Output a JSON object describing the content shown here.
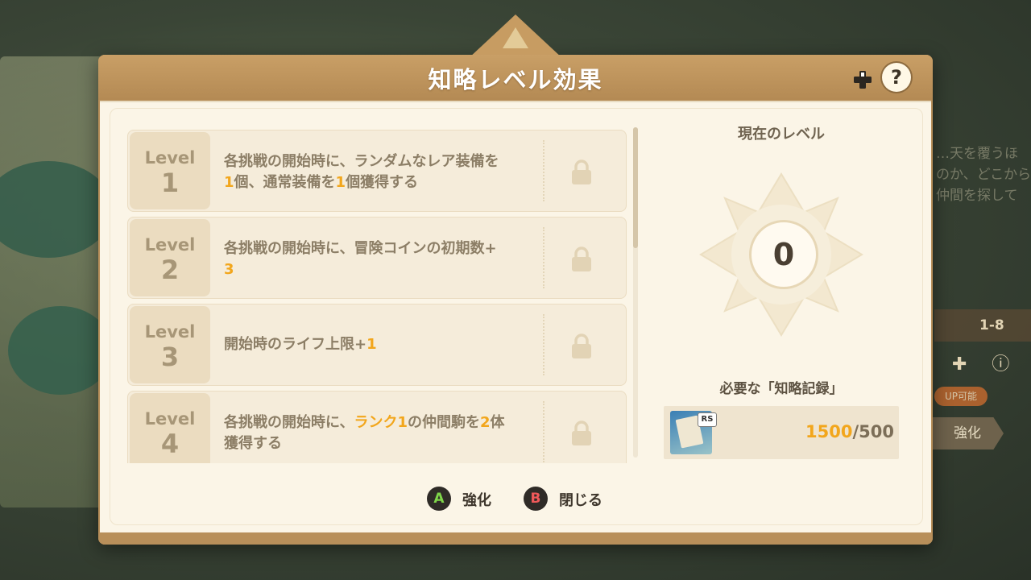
{
  "background": {
    "side_text": [
      "…天を覆うほ",
      "のか、どこから",
      "仲間を探して"
    ],
    "stage": "1-8",
    "badge": "UP可能",
    "enhance": "強化"
  },
  "dialog": {
    "title": "知略レベル効果",
    "help_label": "?"
  },
  "levels": [
    {
      "word": "Level",
      "number": "1",
      "line1": [
        {
          "t": "各挑戦の開始時に、ランダムなレア装備を"
        }
      ],
      "line2": [
        {
          "t": "1",
          "hl": true
        },
        {
          "t": "個、通常装備を"
        },
        {
          "t": "1",
          "hl": true
        },
        {
          "t": "個獲得する"
        }
      ]
    },
    {
      "word": "Level",
      "number": "2",
      "line1": [
        {
          "t": "各挑戦の開始時に、冒険コインの初期数+"
        }
      ],
      "line2": [
        {
          "t": "3",
          "hl": true
        }
      ]
    },
    {
      "word": "Level",
      "number": "3",
      "line1": [
        {
          "t": "開始時のライフ上限+"
        },
        {
          "t": "1",
          "hl": true
        }
      ],
      "line2": []
    },
    {
      "word": "Level",
      "number": "4",
      "line1": [
        {
          "t": "各挑戦の開始時に、"
        },
        {
          "t": "ランク1",
          "hl": true
        },
        {
          "t": "の仲間駒を"
        },
        {
          "t": "2",
          "hl": true
        },
        {
          "t": "体"
        }
      ],
      "line2": [
        {
          "t": "獲得する"
        }
      ]
    }
  ],
  "current_level": {
    "label": "現在のレベル",
    "value": "0"
  },
  "required": {
    "label": "必要な「知略記録」",
    "icon_badge": "RS",
    "have": "1500",
    "need": "/500"
  },
  "footer": {
    "a_key": "A",
    "a_label": "強化",
    "b_key": "B",
    "b_label": "閉じる"
  },
  "colors": {
    "highlight": "#f2a61c",
    "frame": "#b88f5a",
    "panel": "#fbf5e7"
  }
}
